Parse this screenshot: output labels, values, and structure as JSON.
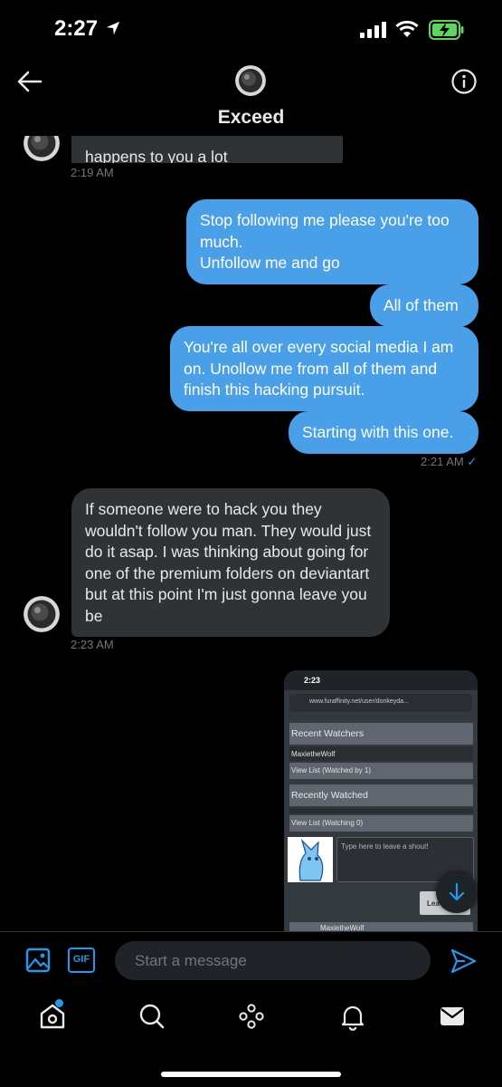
{
  "status_bar": {
    "time": "2:27"
  },
  "header": {
    "title": "Exceed"
  },
  "messages": [
    {
      "text": "happens to you a lot"
    },
    {
      "time": "2:19 AM"
    },
    {
      "text": "Stop following me please you're too much.\nUnfollow me and go"
    },
    {
      "text": "All of them"
    },
    {
      "text": "You're all over every social media I am on. Unollow me from all of them and finish this hacking pursuit."
    },
    {
      "text": "Starting with this one."
    },
    {
      "time": "2:21 AM",
      "check": "✓"
    },
    {
      "text": "If someone were to hack you they wouldn't follow you man. They would just do it asap. I was thinking about going for one of the premium folders on deviantart but at this point I'm just gonna leave you be"
    },
    {
      "time": "2:23 AM"
    }
  ],
  "attachment": {
    "status_time": "2:23",
    "url": "www.furaffinity.net/user/donkeyda...",
    "recent_watchers": "Recent Watchers",
    "watcher_name": "MaxietheWolf",
    "view_list_watched": "View List (Watched by 1)",
    "recently_watched": "Recently Watched",
    "view_list_watching": "View List (Watching 0)",
    "shout_placeholder": "Type here to leave a shout!",
    "leave_button": "Lea",
    "bottom_user": "MaxietheWolf"
  },
  "composer": {
    "placeholder": "Start a message",
    "gif_label": "GIF"
  },
  "colors": {
    "outgoing_bubble": "#4a9fe9",
    "incoming_bubble": "#2f3336",
    "accent": "#1d9bf0"
  }
}
